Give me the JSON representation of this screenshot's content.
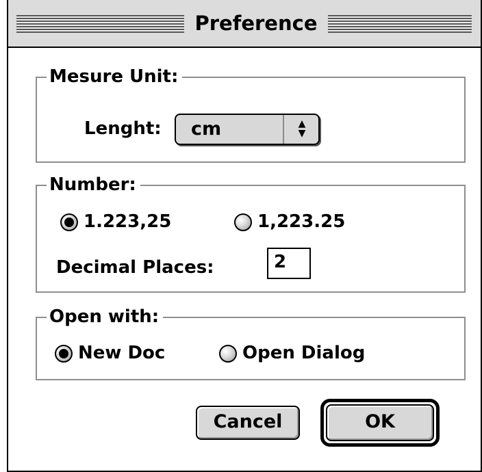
{
  "window": {
    "title": "Preference"
  },
  "measure_unit": {
    "group_label": "Mesure Unit:",
    "length_label": "Lenght:",
    "length_value": "cm",
    "popup_icon": "updown-arrows-icon"
  },
  "number": {
    "group_label": "Number:",
    "format_options": [
      {
        "label": "1.223,25",
        "selected": true
      },
      {
        "label": "1,223.25",
        "selected": false
      }
    ],
    "decimal_places_label": "Decimal Places:",
    "decimal_places_value": "2"
  },
  "open_with": {
    "group_label": "Open with:",
    "options": [
      {
        "label": "New Doc",
        "selected": true
      },
      {
        "label": "Open Dialog",
        "selected": false
      }
    ]
  },
  "buttons": {
    "cancel": "Cancel",
    "ok": "OK"
  }
}
